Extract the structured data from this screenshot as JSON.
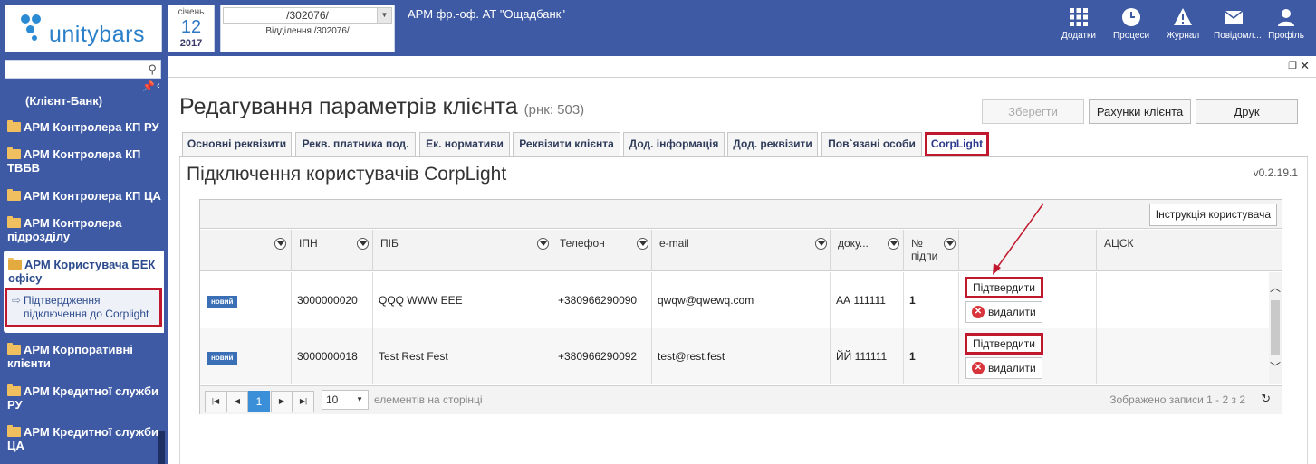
{
  "header": {
    "logo_text": "unitybars",
    "date": {
      "month": "січень",
      "day": "12",
      "year": "2017"
    },
    "branch": {
      "selected": "/302076/",
      "label": "Відділення /302076/"
    },
    "app_title": "АРМ фр.-оф. АТ \"Ощадбанк\"",
    "buttons": [
      {
        "label": "Додатки",
        "icon": "grid-icon"
      },
      {
        "label": "Процеси",
        "icon": "clock-icon"
      },
      {
        "label": "Журнал",
        "icon": "warning-icon"
      },
      {
        "label": "Повідомл...",
        "icon": "mail-icon"
      },
      {
        "label": "Профіль",
        "icon": "user-icon"
      }
    ]
  },
  "sidebar": {
    "search_placeholder": "",
    "items": [
      {
        "label": "(Клієнт-Банк)"
      },
      {
        "label": "АРМ Контролера КП РУ"
      },
      {
        "label": "АРМ Контролера КП ТВБВ"
      },
      {
        "label": "АРМ Контролера КП ЦА"
      },
      {
        "label": "АРМ Контролера підрозділу"
      },
      {
        "label": "АРМ Користувача БЕК офісу"
      },
      {
        "label": "АРМ Корпоративні клієнти"
      },
      {
        "label": "АРМ Кредитної служби РУ"
      },
      {
        "label": "АРМ Кредитної служби ЦА"
      }
    ],
    "active_sub": "Підтвердження підключення до Corplight"
  },
  "page": {
    "title": "Редагування параметрів клієнта",
    "rnk": "(рнк: 503)",
    "save_label": "Зберегти",
    "accounts_label": "Рахунки клієнта",
    "print_label": "Друк",
    "tabs": [
      {
        "label": "Основні реквізити"
      },
      {
        "label": "Рекв. платника под."
      },
      {
        "label": "Ек. нормативи"
      },
      {
        "label": "Реквізити клієнта"
      },
      {
        "label": "Дод. інформація"
      },
      {
        "label": "Дод. реквізити"
      },
      {
        "label": "Пов`язані особи"
      },
      {
        "label": "CorpLight"
      }
    ],
    "section_title": "Підключення користувачів CorpLight",
    "version": "v0.2.19.1",
    "instruction_label": "Інструкція користувача"
  },
  "grid": {
    "columns": [
      "ІПН",
      "ПІБ",
      "Телефон",
      "e-mail",
      "доку...",
      "№ підпи",
      "",
      "АЦСК"
    ],
    "rows": [
      {
        "status": "новий",
        "ipn": "3000000020",
        "pib": "QQQ WWW EEE",
        "phone": "+380966290090",
        "email": "qwqw@qwewq.com",
        "doc": "АА 111111",
        "sign_no": "1",
        "confirm": "Підтвердити",
        "delete": "видалити"
      },
      {
        "status": "новий",
        "ipn": "3000000018",
        "pib": "Test Rest Fest",
        "phone": "+380966290092",
        "email": "test@rest.fest",
        "doc": "ЙЙ 111111",
        "sign_no": "1",
        "confirm": "Підтвердити",
        "delete": "видалити"
      }
    ],
    "pager": {
      "current_page": "1",
      "page_size": "10",
      "per_page_label": "елементів на сторінці",
      "records_info": "Зображено записи 1 - 2 з 2"
    }
  },
  "colors": {
    "brand_blue": "#3e5aa5",
    "highlight_red": "#c0182c",
    "badge_blue": "#3a6fb5",
    "pager_active": "#3a8fd8"
  }
}
